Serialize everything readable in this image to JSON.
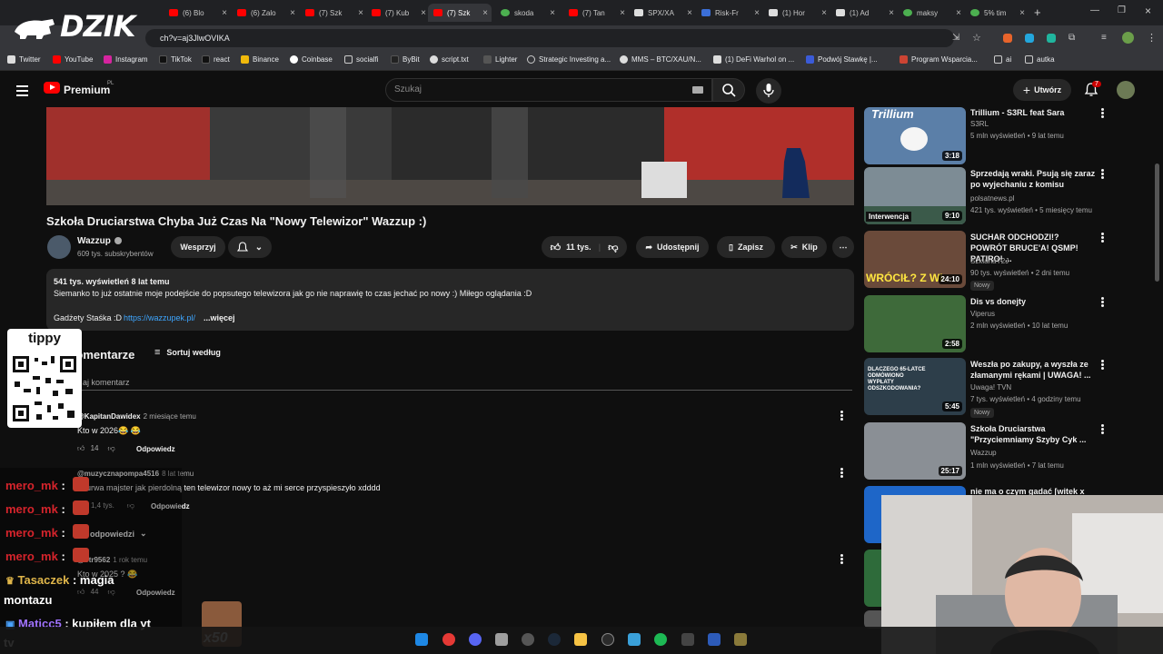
{
  "browser": {
    "tabs": [
      {
        "label": "(6) Blo"
      },
      {
        "label": "(6) Zalo"
      },
      {
        "label": "(7) Szk"
      },
      {
        "label": "(7) Kub"
      },
      {
        "label": "(7) Szk"
      },
      {
        "label": "skoda"
      },
      {
        "label": "(7) Tan"
      },
      {
        "label": "SPX/XA"
      },
      {
        "label": "Risk-Fr"
      },
      {
        "label": "(1) Hor"
      },
      {
        "label": "(1) Ad"
      },
      {
        "label": "maksy"
      },
      {
        "label": "5% tim"
      }
    ],
    "url": "ch?v=aj3JlwOVIKA",
    "bookmarks": [
      {
        "label": "Twitter"
      },
      {
        "label": "YouTube"
      },
      {
        "label": "Instagram"
      },
      {
        "label": "TikTok"
      },
      {
        "label": "react"
      },
      {
        "label": "Binance"
      },
      {
        "label": "Coinbase"
      },
      {
        "label": "socialfi"
      },
      {
        "label": "ByBit"
      },
      {
        "label": "script.txt"
      },
      {
        "label": "Lighter"
      },
      {
        "label": "Strategic Investing a..."
      },
      {
        "label": "MMS – BTC/XAU/N..."
      },
      {
        "label": "(1) DeFi Warhol on ..."
      },
      {
        "label": "Podwój Stawkę |..."
      },
      {
        "label": "Program Wsparcia..."
      },
      {
        "label": "ai"
      },
      {
        "label": "autka"
      }
    ]
  },
  "header": {
    "logo_text": "Premium",
    "logo_region": "PL",
    "search_placeholder": "Szukaj",
    "create_label": "Utwórz",
    "notifications_count": "7"
  },
  "video": {
    "title": "Szkoła Druciarstwa Chyba Już Czas Na \"Nowy Telewizor\" Wazzup :)",
    "channel": "Wazzup",
    "subscribers": "609 tys. subskrybentów",
    "support_label": "Wesprzyj",
    "likes": "11 tys.",
    "share_label": "Udostępnij",
    "save_label": "Zapisz",
    "clip_label": "Klip",
    "views_line": "541 tys. wyświetleń  8 lat temu",
    "description": "Siemanko to już ostatnie moje podejście do popsutego telewizora jak go nie naprawię to czas jechać po nowy :) Miłego oglądania :D",
    "gadgets_label": "Gadżety Staśka :D",
    "gadgets_link": "https://wazzupek.pl/",
    "more_label": "...więcej"
  },
  "comments": {
    "heading": "Komentarze",
    "sort_label": "Sortuj według",
    "add_placeholder": "aj komentarz",
    "items": [
      {
        "author": "@KapitanDawidex",
        "time": "2 miesiące temu",
        "text": "Kto w 2026😂 😂",
        "likes": "14",
        "reply": "Odpowiedz"
      },
      {
        "author": "@muzycznapompa4516",
        "time": "8 lat temu",
        "text": "urwa majster jak pierdolną ten telewizor nowy to aż mi serce przyspieszyło xdddd",
        "likes": "1,4 tys.",
        "reply": "Odpowiedz",
        "replies_label": "odpowiedzi"
      },
      {
        "author": "@otr9562",
        "time": "1 rok temu",
        "text": "Kto w 2025 ? 😂",
        "likes": "44",
        "reply": "Odpowiedz"
      }
    ]
  },
  "sidebar": {
    "items": [
      {
        "title": "Trillium - S3RL feat Sara",
        "channel": "S3RL",
        "meta": "5 mln wyświetleń • 9 lat temu",
        "duration": "3:18",
        "thumb_text": "Trillium",
        "color": "#5b7fa8"
      },
      {
        "title": "Sprzedają wraki. Psują się zaraz po wyjechaniu z komisu",
        "channel": "polsatnews.pl",
        "meta": "421 tys. wyświetleń • 5 miesięcy temu",
        "duration": "9:10",
        "thumb_text": "Interwencja",
        "color": "#7d8c95"
      },
      {
        "title": "SUCHAR ODCHODZI!? POWRÓT BRUCE'A! QSMP! PATIRO! ...",
        "channel": "SzklanaY2J",
        "meta": "90 tys. wyświetleń • 2 dni temu",
        "duration": "24:10",
        "thumb_text": "WRÓCIŁ? Z WŁ",
        "badge": "Nowy",
        "color": "#6a4a3a"
      },
      {
        "title": "Dis vs donejty",
        "channel": "Viperus",
        "meta": "2 mln wyświetleń • 10 lat temu",
        "duration": "2:58",
        "color": "#3e6a3a"
      },
      {
        "title": "Weszła po zakupy, a wyszła ze złamanymi rękami | UWAGA! ...",
        "channel": "Uwaga! TVN",
        "meta": "7 tys. wyświetleń • 4 godziny temu",
        "duration": "5:45",
        "thumb_text": "DLACZEGO 65-LATCE ODMÓWIONO WYPŁATY ODSZKODOWANIA?",
        "badge": "Nowy",
        "color": "#2d3e4a"
      },
      {
        "title": "Szkoła Druciarstwa \"Przyciemniamy Szyby Cyk ...",
        "channel": "Wazzup",
        "meta": "1 mln wyświetleń • 7 lat temu",
        "duration": "25:17",
        "color": "#8a8f95"
      },
      {
        "title": "nie ma o czym gadać [witek x",
        "color": "#1e66c8"
      }
    ]
  },
  "overlay": {
    "watermark": "DZIK",
    "tippy": "tippy",
    "chat": [
      {
        "user": "mero_mk",
        "msg": ":"
      },
      {
        "user": "mero_mk",
        "msg": ":"
      },
      {
        "user": "mero_mk",
        "msg": ":"
      },
      {
        "user": "mero_mk",
        "msg": ":"
      },
      {
        "user": "Tasaczek",
        "msg": ": magia"
      },
      {
        "user": "",
        "msg": "montazu"
      },
      {
        "user": "Maticc5",
        "msg": ": kupiłem dla yt"
      },
      {
        "user": "",
        "msg": "tv"
      }
    ],
    "emote_text": "x50"
  },
  "colors": {
    "accent_red": "#ff0000",
    "chat_red": "#d6242c",
    "chat_gold": "#e0b64a",
    "chat_purple": "#a173ff"
  }
}
